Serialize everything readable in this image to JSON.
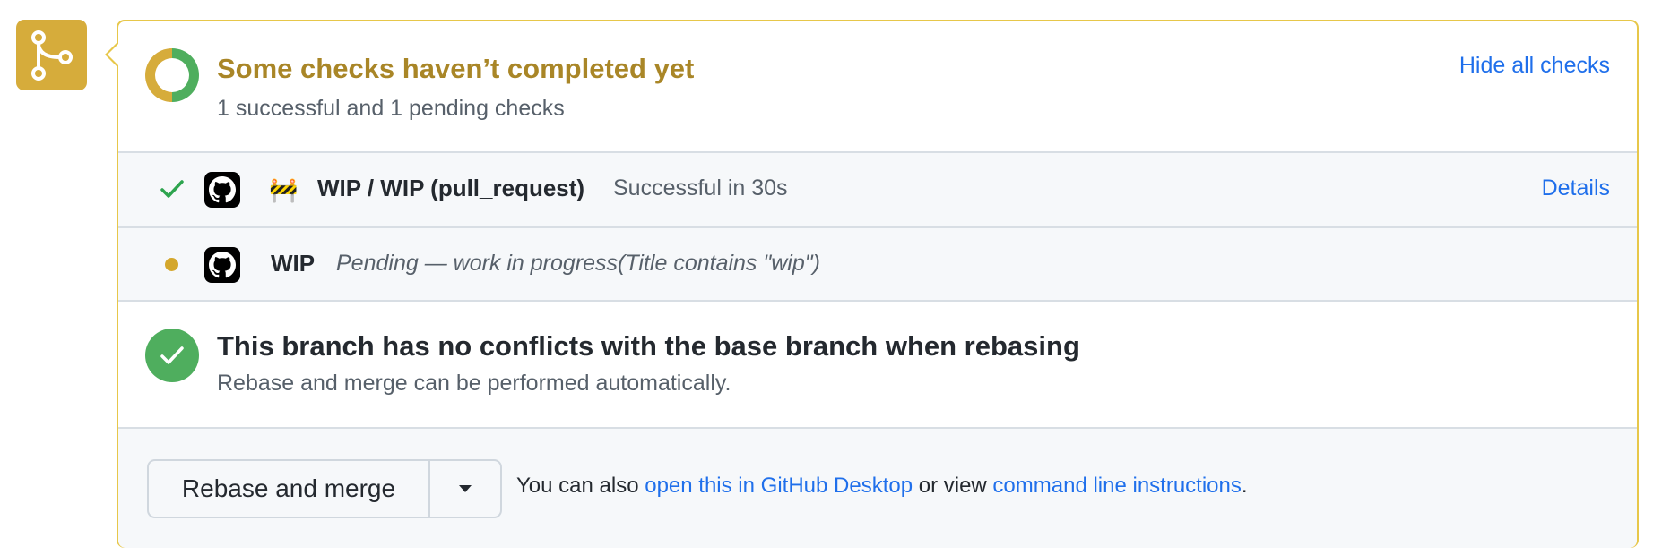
{
  "colors": {
    "pending_yellow": "#d6ac3b",
    "title_gold": "#a98627",
    "success_green": "#4fae5e",
    "link_blue": "#1f6feb",
    "border_yellow": "#e7c74a"
  },
  "merge_icon": "git-merge-icon",
  "status": {
    "title": "Some checks haven’t completed yet",
    "subtitle": "1 successful and 1 pending checks",
    "hide_link": "Hide all checks",
    "successful": 1,
    "pending": 1
  },
  "checks": [
    {
      "status": "success",
      "icon": "github-app-icon",
      "emoji": "🚧",
      "name": "WIP / WIP (pull_request)",
      "description": "Successful in 30s",
      "details_link": "Details"
    },
    {
      "status": "pending",
      "icon": "github-app-icon",
      "name": "WIP",
      "description": "Pending — work in progress(Title contains \"wip\")"
    }
  ],
  "conflicts": {
    "title": "This branch has no conflicts with the base branch when rebasing",
    "subtitle": "Rebase and merge can be performed automatically."
  },
  "merge": {
    "button_label": "Rebase and merge",
    "prefix": "You can also ",
    "desktop_link": "open this in GitHub Desktop",
    "middle": " or view ",
    "cli_link": "command line instructions",
    "suffix": "."
  }
}
